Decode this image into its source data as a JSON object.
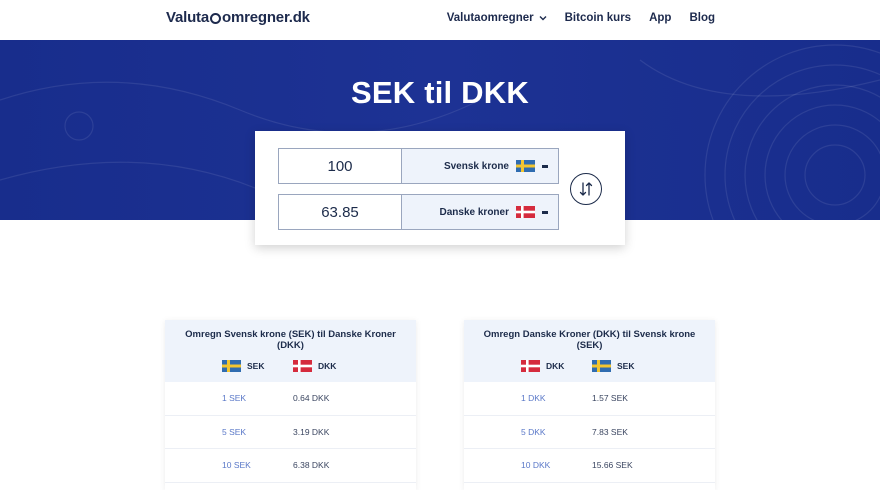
{
  "header": {
    "logo_text_left": "Valuta",
    "logo_text_right": "omregner.dk",
    "nav": [
      {
        "label": "Valutaomregner"
      },
      {
        "label": "Bitcoin kurs"
      },
      {
        "label": "App"
      },
      {
        "label": "Blog"
      }
    ]
  },
  "hero": {
    "title": "SEK til DKK",
    "background": "#1a2f8e"
  },
  "converter": {
    "from": {
      "amount": "100",
      "currency": "Svensk krone",
      "flag": "sweden-flag"
    },
    "to": {
      "amount": "63.85",
      "currency": "Danske kroner",
      "flag": "denmark-flag"
    },
    "swap_icon": "swap-arrows-icon"
  },
  "tables": [
    {
      "title": "Omregn Svensk krone (SEK) til Danske Kroner (DKK)",
      "col1": "SEK",
      "col2": "DKK",
      "rows": [
        {
          "from": "1 SEK",
          "to": "0.64 DKK"
        },
        {
          "from": "5 SEK",
          "to": "3.19 DKK"
        },
        {
          "from": "10 SEK",
          "to": "6.38 DKK"
        }
      ]
    },
    {
      "title": "Omregn Danske Kroner (DKK) til Svensk krone (SEK)",
      "col1": "DKK",
      "col2": "SEK",
      "rows": [
        {
          "from": "1 DKK",
          "to": "1.57 SEK"
        },
        {
          "from": "5 DKK",
          "to": "7.83 SEK"
        },
        {
          "from": "10 DKK",
          "to": "15.66 SEK"
        }
      ]
    }
  ],
  "colors": {
    "accent": "#1a2f8e",
    "link": "#5a78c8",
    "panel": "#eef3fb"
  }
}
